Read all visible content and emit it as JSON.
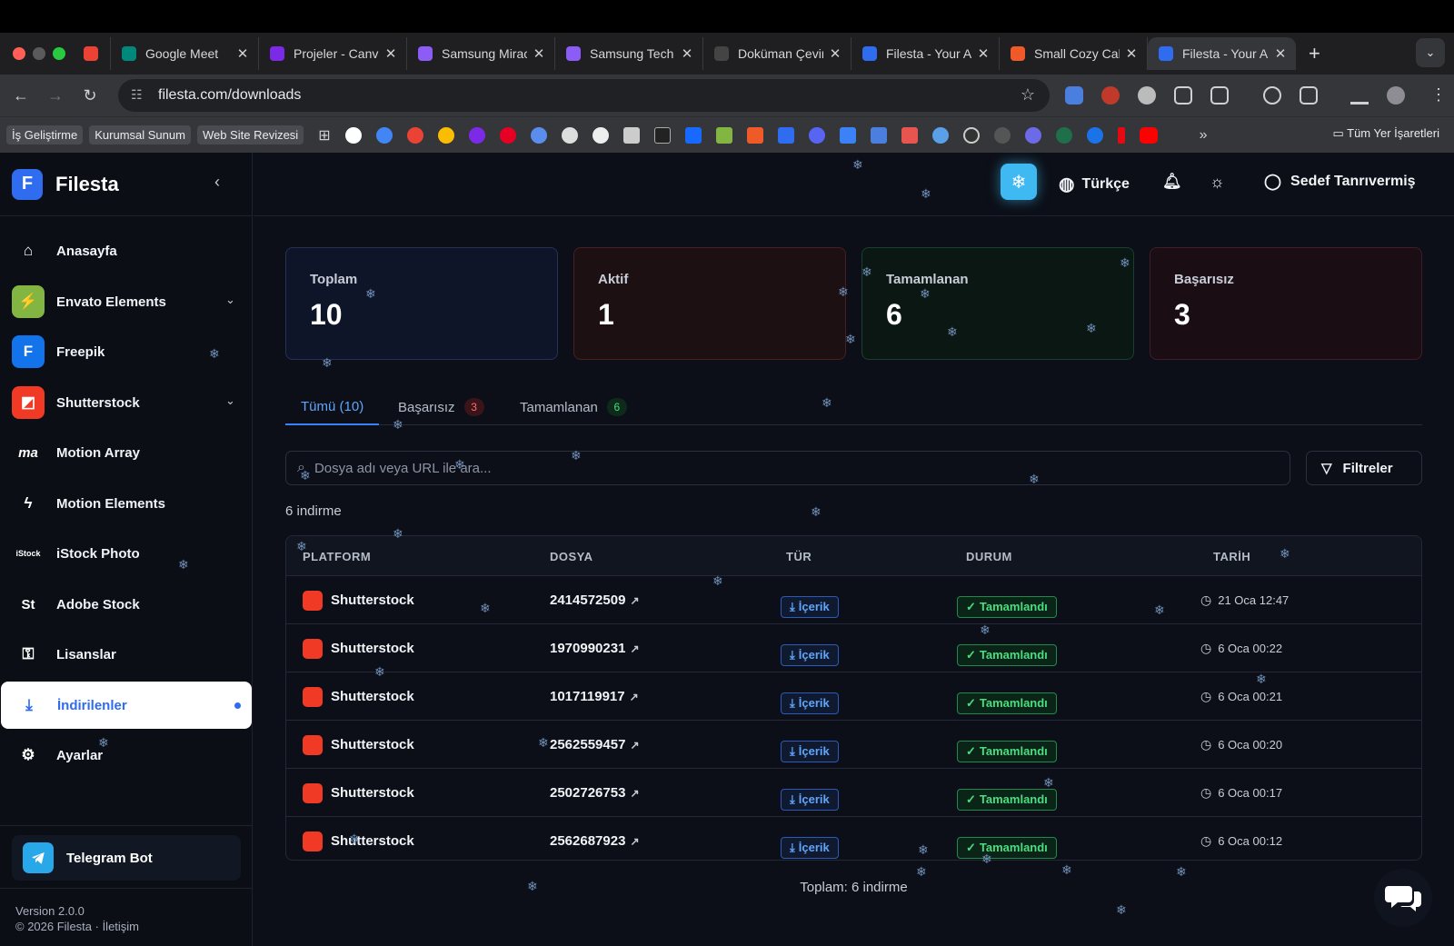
{
  "browser": {
    "tabs": [
      {
        "title": "",
        "icon": "gmail-icon",
        "color": "#ea4335"
      },
      {
        "title": "Google Meet",
        "icon": "meet-icon",
        "color": "#00897b"
      },
      {
        "title": "Projeler - Canva",
        "icon": "canva-icon",
        "color": "#7d2ae8"
      },
      {
        "title": "Samsung Miracast",
        "icon": "samsung-icon",
        "color": "#8b5cf6"
      },
      {
        "title": "Samsung Tech",
        "icon": "samsung-icon",
        "color": "#8b5cf6"
      },
      {
        "title": "Doküman Çeviri",
        "icon": "openai-icon",
        "color": "#444"
      },
      {
        "title": "Filesta - Your All",
        "icon": "filesta-icon",
        "color": "#2f6cf0"
      },
      {
        "title": "Small Cozy Cabin",
        "icon": "shutterstock-icon",
        "color": "#f05a28"
      },
      {
        "title": "Filesta - Your All",
        "icon": "filesta-icon",
        "color": "#2f6cf0",
        "active": true
      }
    ],
    "url": "filesta.com/downloads",
    "bookmarks": [
      "İş Geliştirme",
      "Kurumsal Sunum",
      "Web Site Revizesi"
    ],
    "bookmarks_folder": "Tüm Yer İşaretleri"
  },
  "app": {
    "brand": "Filesta",
    "logo_letter": "F",
    "language": "Türkçe",
    "user": "Sedef Tanrıvermiş"
  },
  "sidebar": {
    "items": [
      {
        "label": "Anasayfa",
        "icon": "home-icon"
      },
      {
        "label": "Envato Elements",
        "icon": "envato-icon",
        "color": "#82b541",
        "expandable": true
      },
      {
        "label": "Freepik",
        "icon": "freepik-icon",
        "color": "#1273eb"
      },
      {
        "label": "Shutterstock",
        "icon": "shutterstock-icon",
        "color": "#f03a26",
        "expandable": true
      },
      {
        "label": "Motion Array",
        "icon": "motion-array-icon",
        "glyph": "ma"
      },
      {
        "label": "Motion Elements",
        "icon": "motion-elements-icon"
      },
      {
        "label": "iStock Photo",
        "icon": "istock-icon",
        "glyph": "iStock"
      },
      {
        "label": "Adobe Stock",
        "icon": "adobe-stock-icon",
        "glyph": "St"
      },
      {
        "label": "Lisanslar",
        "icon": "key-icon"
      },
      {
        "label": "İndirilenler",
        "icon": "download-icon",
        "active": true
      },
      {
        "label": "Ayarlar",
        "icon": "gear-icon"
      }
    ],
    "telegram": "Telegram Bot",
    "version": "Version 2.0.0",
    "copyright": "© 2026 Filesta · İletişim"
  },
  "stats": [
    {
      "label": "Toplam",
      "value": "10",
      "bg": "#0f1529",
      "border": "#24305a"
    },
    {
      "label": "Aktif",
      "value": "1",
      "bg": "#1c1012",
      "border": "#4a1e22"
    },
    {
      "label": "Tamamlanan",
      "value": "6",
      "bg": "#0b1712",
      "border": "#174030"
    },
    {
      "label": "Başarısız",
      "value": "3",
      "bg": "#1a0d14",
      "border": "#441b2a"
    }
  ],
  "filter_tabs": [
    {
      "label": "Tümü (10)",
      "badge": "",
      "active": true
    },
    {
      "label": "Başarısız",
      "badge": "3",
      "badge_color": "#f87171",
      "badge_bg": "#3a1418"
    },
    {
      "label": "Tamamlanan",
      "badge": "6",
      "badge_color": "#4ade80",
      "badge_bg": "#0d2a1a"
    }
  ],
  "search": {
    "placeholder": "Dosya adı veya URL ile ara..."
  },
  "filters_label": "Filtreler",
  "result_count": "6 indirme",
  "table": {
    "columns": [
      "PLATFORM",
      "DOSYA",
      "TÜR",
      "DURUM",
      "TARİH"
    ],
    "rows": [
      {
        "platform": "Shutterstock",
        "file": "2414572509",
        "type": "İçerik",
        "status": "Tamamlandı",
        "date": "21 Oca 12:47"
      },
      {
        "platform": "Shutterstock",
        "file": "1970990231",
        "type": "İçerik",
        "status": "Tamamlandı",
        "date": "6 Oca 00:22"
      },
      {
        "platform": "Shutterstock",
        "file": "1017119917",
        "type": "İçerik",
        "status": "Tamamlandı",
        "date": "6 Oca 00:21"
      },
      {
        "platform": "Shutterstock",
        "file": "2562559457",
        "type": "İçerik",
        "status": "Tamamlandı",
        "date": "6 Oca 00:20"
      },
      {
        "platform": "Shutterstock",
        "file": "2502726753",
        "type": "İçerik",
        "status": "Tamamlandı",
        "date": "6 Oca 00:17"
      },
      {
        "platform": "Shutterstock",
        "file": "2562687923",
        "type": "İçerik",
        "status": "Tamamlandı",
        "date": "6 Oca 00:12"
      }
    ],
    "footer": "Toplam: 6 indirme"
  }
}
